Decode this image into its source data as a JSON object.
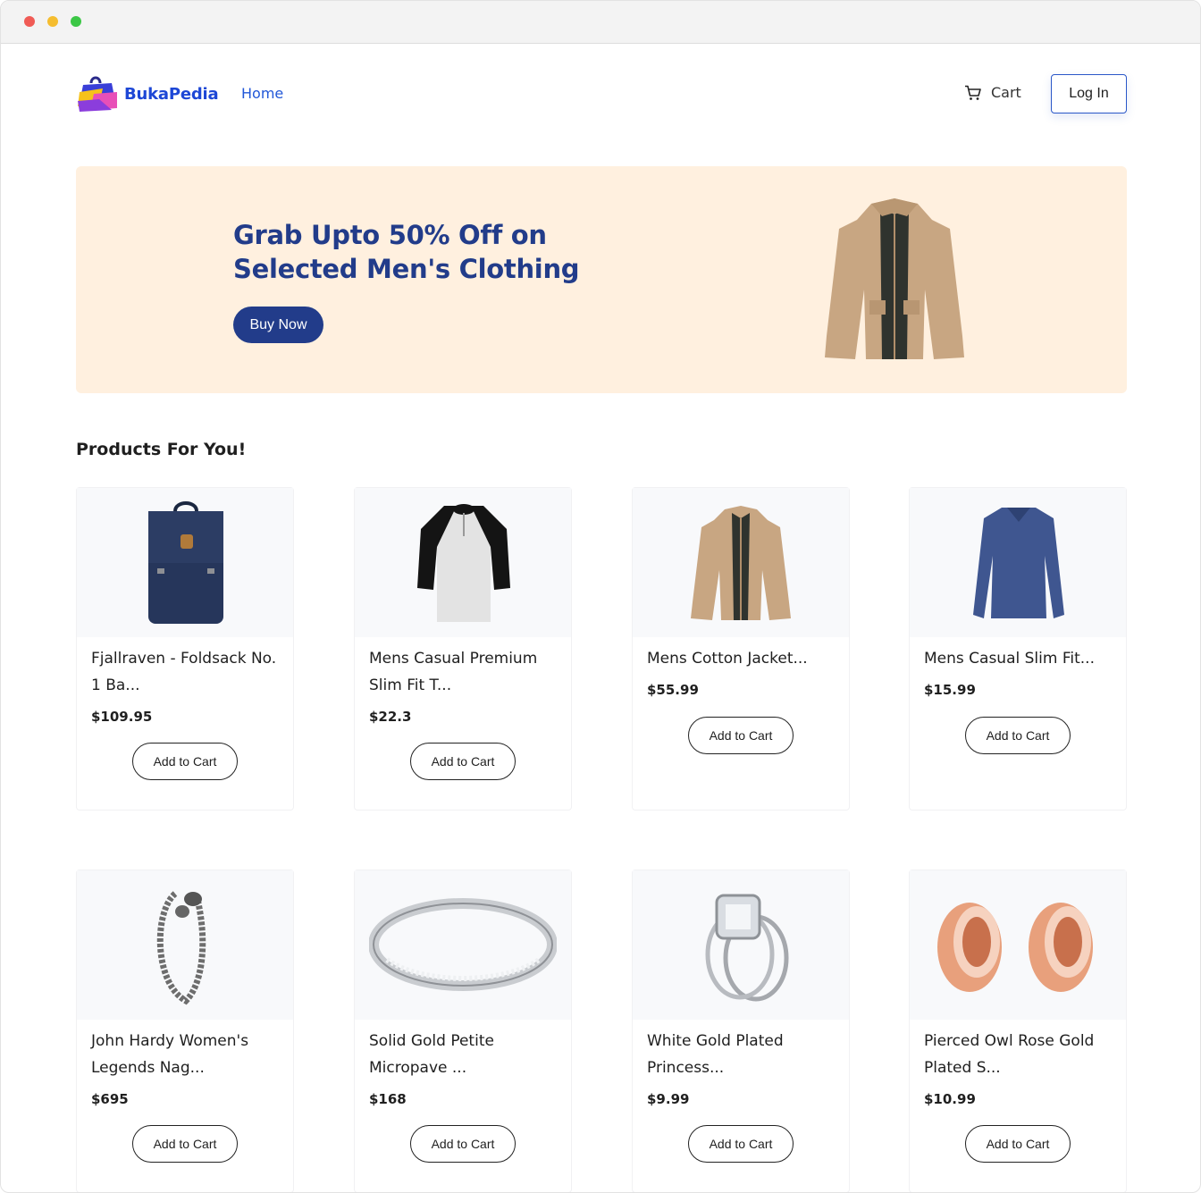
{
  "brand": {
    "name": "BukaPedia"
  },
  "nav": {
    "home": "Home",
    "cart": "Cart",
    "login": "Log In"
  },
  "banner": {
    "title": "Grab Upto 50% Off on Selected Men's Clothing",
    "button": "Buy Now",
    "image": "tan-jacket-image"
  },
  "products_section": {
    "title": "Products For You!"
  },
  "products": [
    {
      "name": "Fjallraven - Foldsack No. 1 Ba...",
      "price": "$109.95",
      "button": "Add to Cart",
      "image": "navy-backpack-image"
    },
    {
      "name": "Mens Casual Premium Slim Fit T...",
      "price": "$22.3",
      "button": "Add to Cart",
      "image": "raglan-tshirt-image"
    },
    {
      "name": "Mens Cotton Jacket...",
      "price": "$55.99",
      "button": "Add to Cart",
      "image": "tan-jacket-image"
    },
    {
      "name": "Mens Casual Slim Fit...",
      "price": "$15.99",
      "button": "Add to Cart",
      "image": "blue-longsleeve-image"
    },
    {
      "name": "John Hardy Women's Legends Nag...",
      "price": "$695",
      "button": "Add to Cart",
      "image": "silver-bracelet-image"
    },
    {
      "name": "Solid Gold Petite Micropave ...",
      "price": "$168",
      "button": "Add to Cart",
      "image": "silver-ring-image"
    },
    {
      "name": "White Gold Plated Princess...",
      "price": "$9.99",
      "button": "Add to Cart",
      "image": "diamond-ring-image"
    },
    {
      "name": "Pierced Owl Rose Gold Plated S...",
      "price": "$10.99",
      "button": "Add to Cart",
      "image": "rose-gold-plugs-image"
    }
  ],
  "colors": {
    "brand_blue": "#1d47d6",
    "banner_bg": "#fff0df",
    "banner_title": "#223c8a"
  }
}
